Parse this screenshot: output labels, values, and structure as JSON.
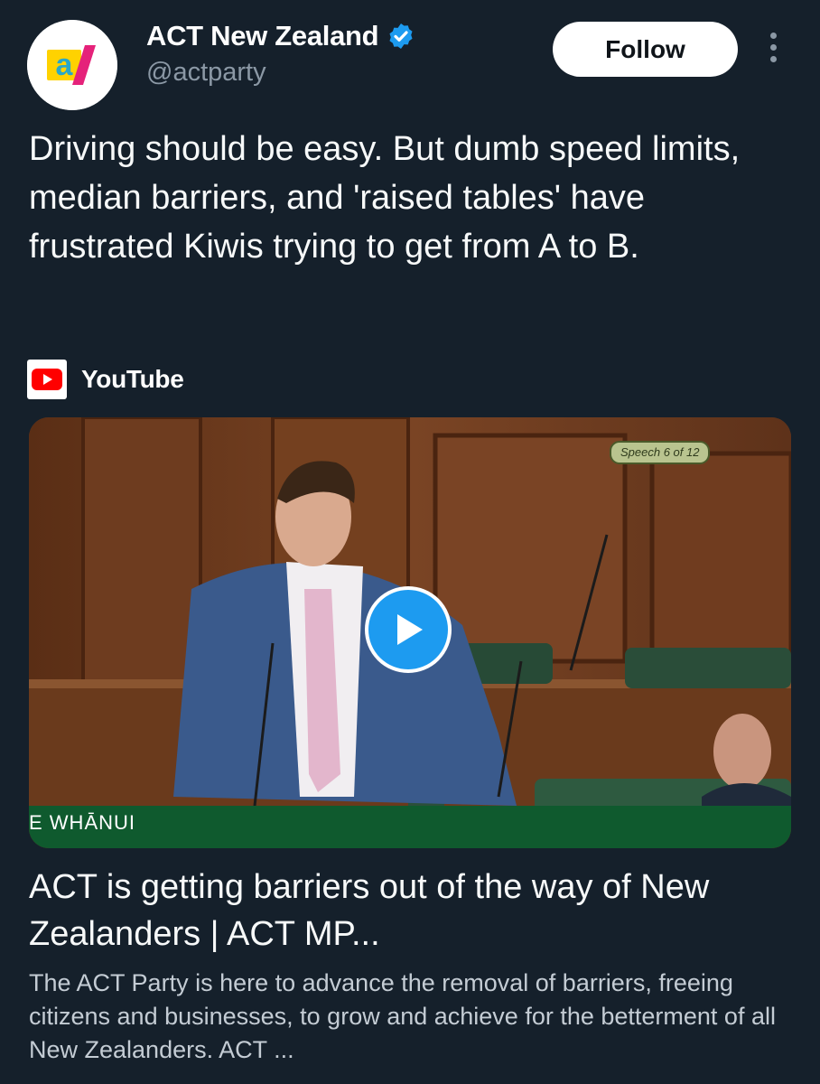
{
  "account": {
    "display_name": "ACT New Zealand",
    "handle": "@actparty",
    "verified": true,
    "avatar_logo_text": "a/"
  },
  "actions": {
    "follow_label": "Follow",
    "more_icon": "more-vertical-icon"
  },
  "post": {
    "text": "Driving should be easy. But dumb speed limits, median barriers, and 'raised tables' have frustrated Kiwis trying to get from A to B."
  },
  "link_card": {
    "source_name": "YouTube",
    "source_icon": "youtube-logo-icon",
    "thumbnail": {
      "badge": "Speech 6 of 12",
      "lower_third": "E WHĀNUI",
      "play_icon": "play-icon"
    },
    "title": "ACT is getting barriers out of the way of New Zealanders | ACT MP...",
    "description": "The ACT Party is here to advance the removal of barriers, freeing citizens and businesses, to grow and achieve for the betterment of all New Zealanders. ACT ..."
  },
  "colors": {
    "background": "#15202b",
    "accent_blue": "#1d9bf0",
    "muted_text": "#8b98a5",
    "youtube_red": "#ff0000"
  }
}
